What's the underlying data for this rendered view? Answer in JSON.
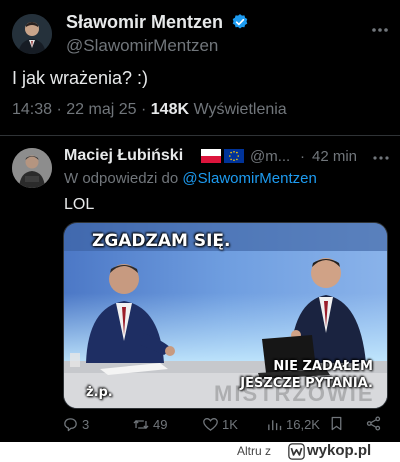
{
  "main_tweet": {
    "author_name": "Sławomir Mentzen",
    "author_handle": "@SlawomirMentzen",
    "text": "I jak wrażenia? :)",
    "time": "14:38",
    "date": "22 maj 25",
    "views_count": "148K",
    "views_label": "Wyświetlenia"
  },
  "reply": {
    "author_name": "Maciej Łubiński",
    "handle_truncated": "@m...",
    "separator": "·",
    "time": "42 min",
    "in_reply_label": "W odpowiedzi do",
    "in_reply_handle": "@SlawomirMentzen",
    "text": "LOL",
    "media": {
      "caption_top": "ZGADZAM SIĘ.",
      "caption_bottom_line1": "NIE ZADAŁEM",
      "caption_bottom_line2": "JESZCZE PYTANIA.",
      "caption_corner": "ż.p.",
      "studio_watermark": "MISTRZOWIE"
    },
    "actions": {
      "replies": "3",
      "reposts": "49",
      "likes": "1K",
      "views": "16,2K"
    }
  },
  "watermark": {
    "prefix": "Altru z",
    "site": "wykop.pl"
  },
  "colors": {
    "background": "#000000",
    "text": "#e7e9ea",
    "muted": "#71767b",
    "accent": "#1d9bf0",
    "divider": "#2f3336"
  },
  "icons": [
    "verified-badge-icon",
    "more-icon",
    "reply-icon",
    "repost-icon",
    "like-icon",
    "views-icon",
    "share-icon",
    "poland-flag-icon",
    "eu-flag-icon",
    "wykop-logo-icon"
  ]
}
